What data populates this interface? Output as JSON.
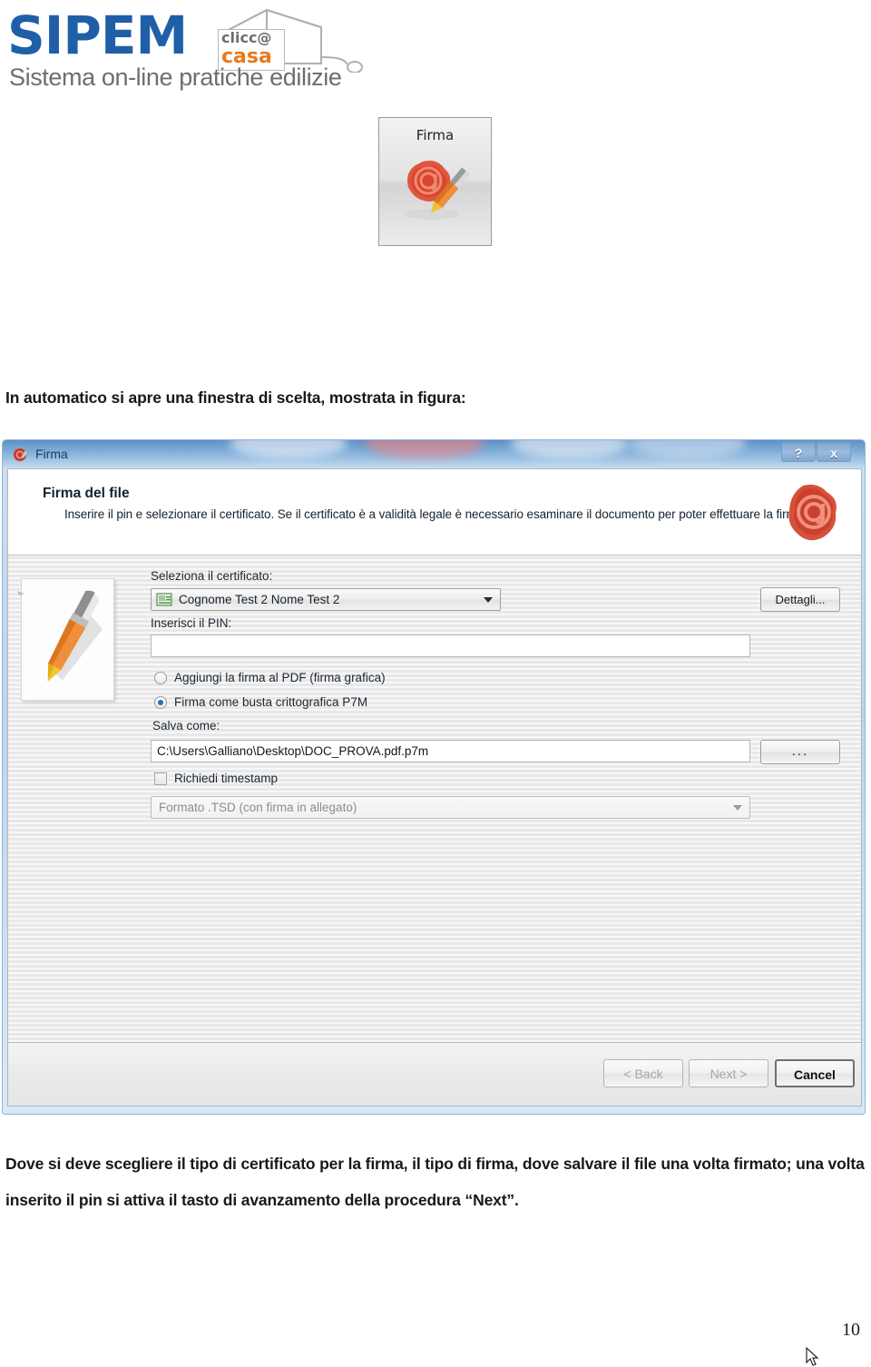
{
  "document": {
    "page_number": "10",
    "paragraph_intro": "In automatico si apre una finestra di scelta, mostrata in figura:",
    "paragraph_after": "Dove si deve scegliere il tipo di certificato per la firma, il tipo di firma, dove salvare il file una volta firmato; una volta inserito il pin si attiva il tasto di avanzamento della procedura “Next”."
  },
  "logo": {
    "brand": "SIPEM",
    "badge_line1": "clicc@",
    "badge_line2": "casa",
    "tagline": "Sistema on-line pratiche edilizie",
    "brand_color": "#1F5FA8",
    "accent_color": "#E8791B"
  },
  "firma_thumb": {
    "label": "Firma",
    "icon": "wax-seal-pen-icon"
  },
  "dialog": {
    "titlebar": {
      "icon": "firma-seal-icon",
      "title": "Firma",
      "help_label": "?",
      "close_label": "x"
    },
    "header": {
      "title": "Firma del file",
      "subtitle": "Inserire il pin e selezionare il certificato. Se il certificato è a validità legale è necessario esaminare il documento per poter effettuare la firma",
      "seal_icon": "wax-seal-at-icon"
    },
    "side_panel": {
      "image": "orange-pen-icon"
    },
    "form": {
      "certificate_label": "Seleziona il certificato:",
      "certificate_value": "Cognome Test 2 Nome Test 2",
      "certificate_icon": "certificate-icon",
      "details_button": "Dettagli...",
      "pin_label": "Inserisci il PIN:",
      "pin_value": "",
      "pin_placeholder": "",
      "radio_pdf_label": "Aggiungi la firma al PDF (firma grafica)",
      "radio_pdf_checked": false,
      "radio_p7m_label": "Firma come busta crittografica P7M",
      "radio_p7m_checked": true,
      "saveas_label": "Salva come:",
      "saveas_value": "C:\\Users\\Galliano\\Desktop\\DOC_PROVA.pdf.p7m",
      "browse_button": "...",
      "timestamp_label": "Richiedi timestamp",
      "timestamp_checked": false,
      "format_value": "Formato .TSD (con firma in allegato)"
    },
    "footer": {
      "back_label": "< Back",
      "back_enabled": false,
      "next_label": "Next >",
      "next_enabled": false,
      "cancel_label": "Cancel",
      "cancel_enabled": true
    }
  }
}
